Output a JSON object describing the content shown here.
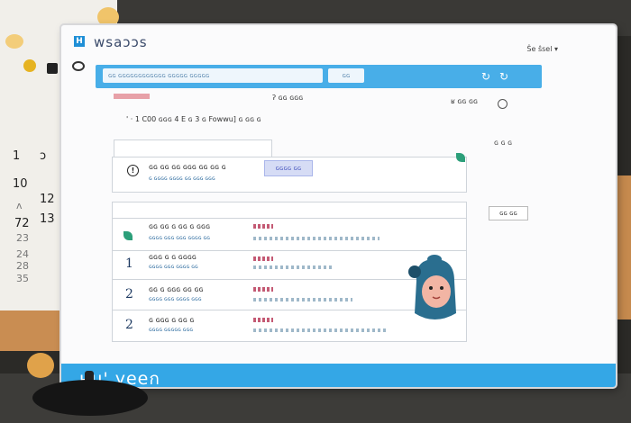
{
  "app": {
    "logo_letter": "H",
    "title": "wsaɔɔs",
    "user_menu": "Ŝe ŝsel ▾",
    "bottom_banner": "ʜu' yeeก"
  },
  "topbar": {
    "search_text": "ɢɢ ɢɢɢɢɢɢɢɢɢɢɢɢ ɢɢɢɢɢ ɢɢɢɢɢ",
    "search_side": "ɢɢ",
    "refresh_icons": [
      "↻",
      "↻"
    ]
  },
  "subheader": {
    "center_label": "ʔ ɢɢ ɢɢɢ",
    "right_label": "ʁ ɢɢ ɢɢ",
    "info_line": "ꞌ · 1 C00 ɢɢɢ 4 E ɢ 3 ɢ Fowwu] ɢ ɢɢ ɢ"
  },
  "sidebar": {
    "caption": "ɢ   ɢ ɢ",
    "tab_chip": "ɢɢ ɢɢ"
  },
  "alert_card": {
    "icon": "!",
    "title": "ɢɢ  ɢɢ ɢɢ ɢɢɢ ɢɢ ɢɢ ɢ",
    "meta": "ɢ ɢɢɢɢ ɢɢɢɢ ɢɢ ɢɢɢ ɢɢɢ",
    "action_label": "ɢɢɢɢ ɢɢ"
  },
  "list": [
    {
      "marker": "",
      "title": "ɢɢ ɢɢ ɢ ɢɢ ɢ ɢɢɢ",
      "meta": "ɢɢɢɢ ɢɢɢ ɢɢɢ ɢɢɢɢ ɢɢ"
    },
    {
      "marker": "1",
      "title": "ɢɢɢ ɢ ɢ ɢɢɢɢ",
      "meta": "ɢɢɢɢ ɢɢɢ ɢɢɢɢ ɢɢ"
    },
    {
      "marker": "2",
      "title": "ɢɢ ɢ ɢɢɢ ɢɢ ɢɢ",
      "meta": "ɢɢɢɢ ɢɢɢ ɢɢɢɢ ɢɢɢ"
    },
    {
      "marker": "2",
      "title": "ɢ ɢɢɢ ɢ ɢɢ ɢ",
      "meta": "ɢɢɢɢ ɢɢɢɢɢ ɢɢɢ"
    }
  ],
  "calendar": {
    "numbers": [
      "1",
      "ɔ",
      "10",
      "12",
      "ʌ",
      "72",
      "13",
      "23",
      "24",
      "28",
      "35"
    ]
  },
  "colors": {
    "accent": "#34a7e6",
    "topbar": "#48aee8",
    "action": "#4a58c0",
    "mascot": "#2a6e8f"
  }
}
